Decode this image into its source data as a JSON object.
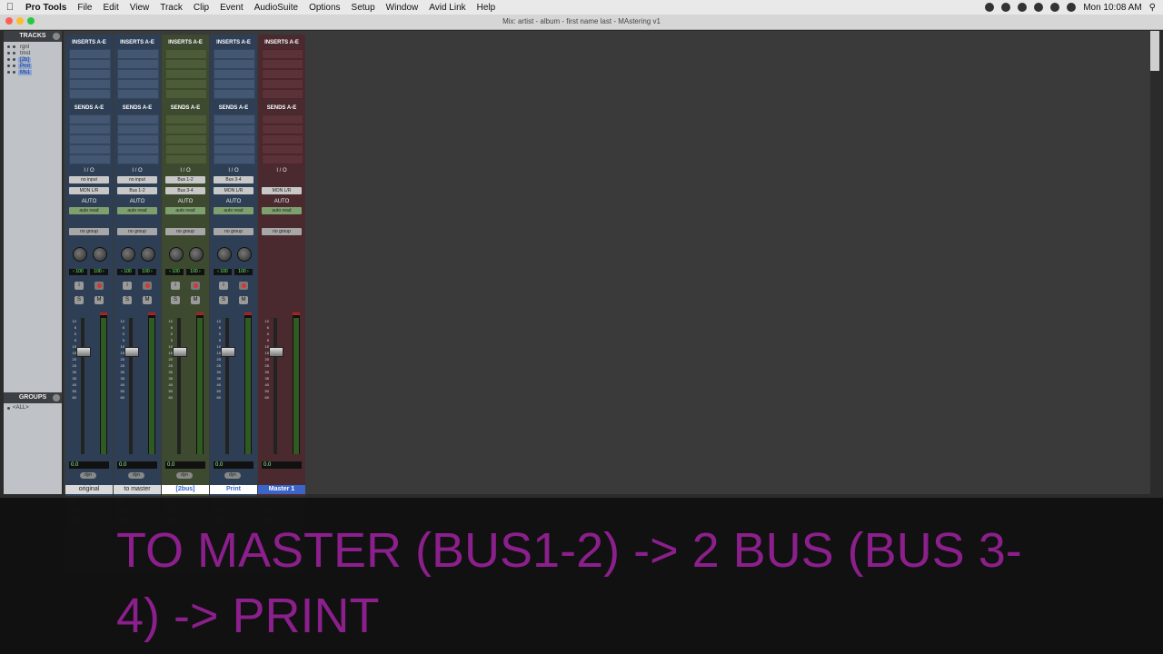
{
  "menubar": {
    "app_name": "Pro Tools",
    "items": [
      "File",
      "Edit",
      "View",
      "Track",
      "Clip",
      "Event",
      "AudioSuite",
      "Options",
      "Setup",
      "Window",
      "Avid Link",
      "Help"
    ],
    "clock": "Mon 10:08 AM"
  },
  "window": {
    "title": "Mix: artist - album - first name last - MAstering v1"
  },
  "tracks_panel": {
    "title": "TRACKS",
    "items": [
      {
        "label": "rgnl",
        "selected": false
      },
      {
        "label": "tmst",
        "selected": false
      },
      {
        "label": "[2b]",
        "selected": true
      },
      {
        "label": "Prnt",
        "selected": true
      },
      {
        "label": "Ms1",
        "selected": true
      }
    ]
  },
  "groups_panel": {
    "title": "GROUPS",
    "all_label": "<ALL>"
  },
  "strip_labels": {
    "inserts": "INSERTS A-E",
    "sends": "SENDS A-E",
    "io": "I / O",
    "auto": "AUTO",
    "dyn": "dyn",
    "scale": [
      "12",
      "6",
      "0",
      "5",
      "10",
      "15",
      "20",
      "25",
      "30",
      "35",
      "40",
      "50",
      "60"
    ]
  },
  "strips": [
    {
      "name": "original",
      "color": "blue",
      "input": "no input",
      "output": "MON L/R",
      "automation": "auto read",
      "group": "no group",
      "pan_left": "‹ 100",
      "pan_right": "100 ›",
      "volume": "0.0",
      "name_style": "plain"
    },
    {
      "name": "to master",
      "color": "blue",
      "input": "no input",
      "output": "Bus 1-2",
      "automation": "auto read",
      "group": "no group",
      "pan_left": "‹ 100",
      "pan_right": "100 ›",
      "volume": "0.0",
      "name_style": "plain"
    },
    {
      "name": "[2bus]",
      "color": "green",
      "input": "Bus 1-2",
      "output": "Bus 3-4",
      "automation": "auto read",
      "group": "no group",
      "pan_left": "‹ 100",
      "pan_right": "100 ›",
      "volume": "0.0",
      "name_style": "sel"
    },
    {
      "name": "Print",
      "color": "blue",
      "input": "Bus 3-4",
      "output": "MON L/R",
      "automation": "auto read",
      "group": "no group",
      "pan_left": "‹ 100",
      "pan_right": "100 ›",
      "volume": "0.0",
      "name_style": "sel"
    },
    {
      "name": "Master 1",
      "color": "red",
      "input": "",
      "output": "MON L/R",
      "automation": "auto read",
      "group": "no group",
      "pan_left": "",
      "pan_right": "",
      "volume": "0.0",
      "name_style": "master"
    }
  ],
  "lower_panel": {
    "lines": [
      "dly",
      "+/-",
      "cmp"
    ],
    "value": "0"
  },
  "caption": {
    "text": "TO MASTER (BUS1-2) -> 2 BUS (BUS 3-4) -> PRINT",
    "color": "#8b1f8b"
  }
}
